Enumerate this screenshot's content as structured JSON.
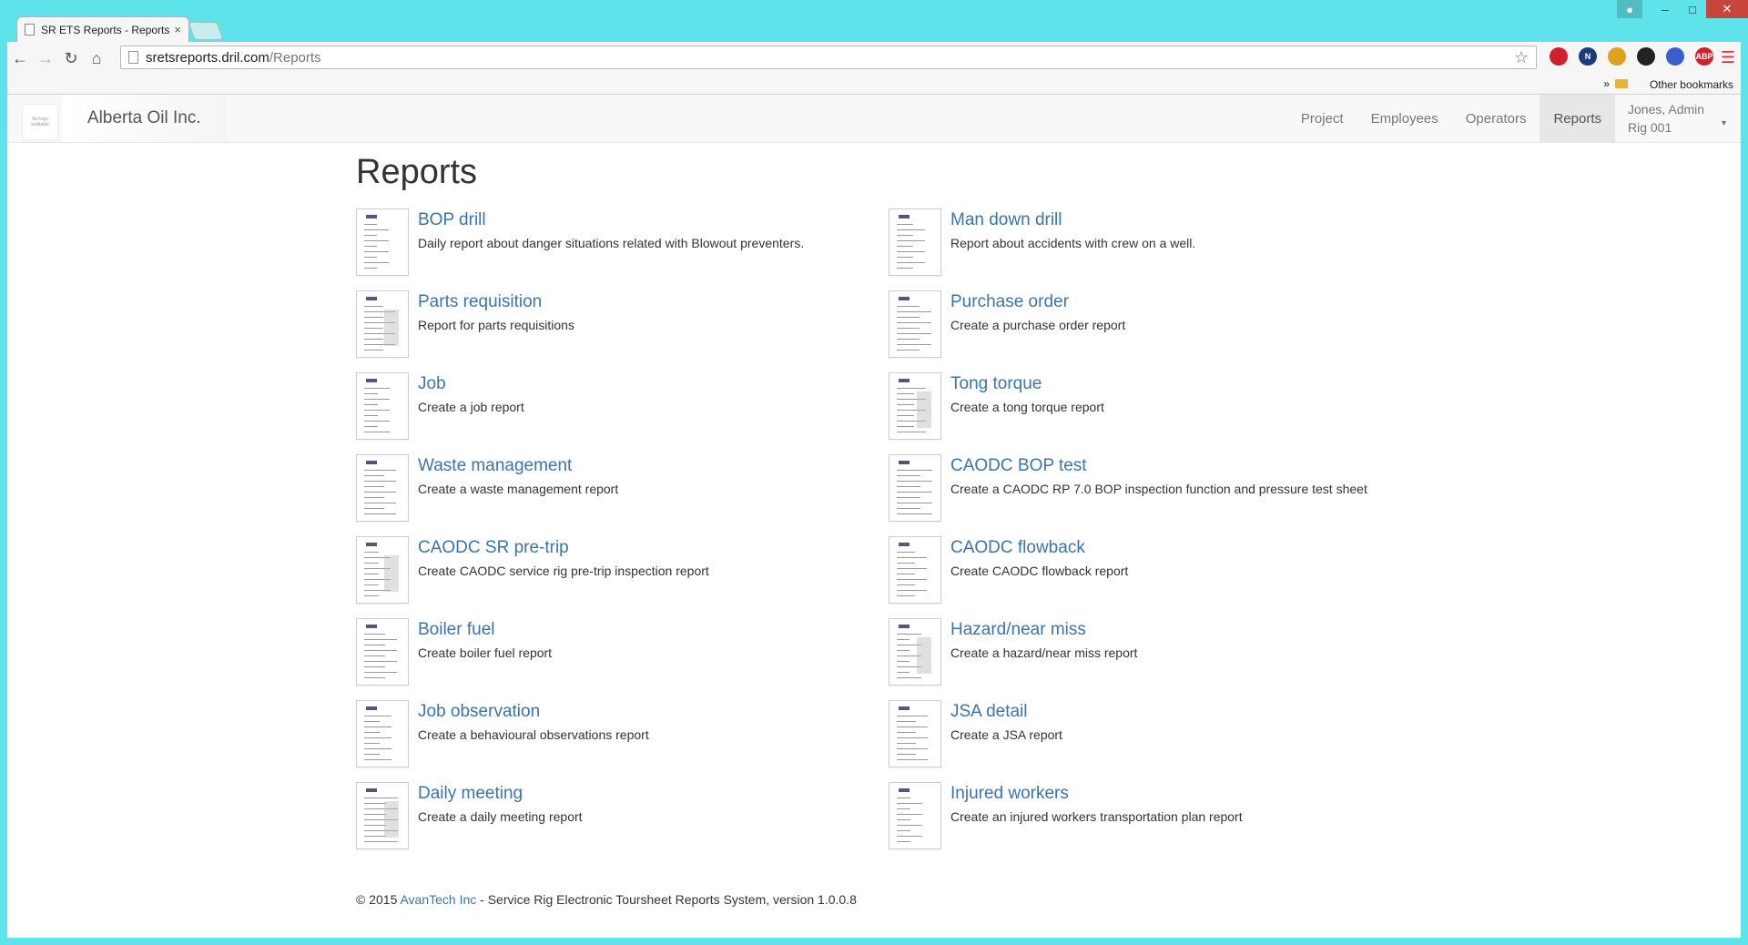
{
  "browser": {
    "tab_title": "SR ETS Reports - Reports",
    "tab_close": "×",
    "url_host": "sretsreports.dril.com",
    "url_path": "/Reports",
    "bookmarks_chevron": "»",
    "other_bookmarks": "Other bookmarks",
    "extensions": [
      {
        "name": "opera-icon",
        "label": "",
        "color": "#d0202a"
      },
      {
        "name": "notes-icon",
        "label": "N",
        "color": "#1b3b7c"
      },
      {
        "name": "pinwheel-icon",
        "label": "",
        "color": "#e0a020"
      },
      {
        "name": "eye-icon",
        "label": "",
        "color": "#222222"
      },
      {
        "name": "globe-icon",
        "label": "",
        "color": "#3a5fcc"
      },
      {
        "name": "adblock-icon",
        "label": "ABP",
        "color": "#d0202a"
      }
    ]
  },
  "navbar": {
    "logo_text": "No logo available",
    "brand": "Alberta Oil Inc.",
    "links": [
      "Project",
      "Employees",
      "Operators",
      "Reports"
    ],
    "active_link": "Reports",
    "user_name": "Jones, Admin",
    "user_rig": "Rig 001"
  },
  "page_title": "Reports",
  "reports_left": [
    {
      "title": "BOP drill",
      "desc": "Daily report about danger situations related with Blowout preventers."
    },
    {
      "title": "Parts requisition",
      "desc": "Report for parts requisitions"
    },
    {
      "title": "Job",
      "desc": "Create a job report"
    },
    {
      "title": "Waste management",
      "desc": "Create a waste management report"
    },
    {
      "title": "CAODC SR pre-trip",
      "desc": "Create CAODC service rig pre-trip inspection report"
    },
    {
      "title": "Boiler fuel",
      "desc": "Create boiler fuel report"
    },
    {
      "title": "Job observation",
      "desc": "Create a behavioural observations report"
    },
    {
      "title": "Daily meeting",
      "desc": "Create a daily meeting report"
    }
  ],
  "reports_right": [
    {
      "title": "Man down drill",
      "desc": "Report about accidents with crew on a well."
    },
    {
      "title": "Purchase order",
      "desc": "Create a purchase order report"
    },
    {
      "title": "Tong torque",
      "desc": "Create a tong torque report"
    },
    {
      "title": "CAODC BOP test",
      "desc": "Create a CAODC RP 7.0 BOP inspection function and pressure test sheet"
    },
    {
      "title": "CAODC flowback",
      "desc": "Create CAODC flowback report"
    },
    {
      "title": "Hazard/near miss",
      "desc": "Create a hazard/near miss report"
    },
    {
      "title": "JSA detail",
      "desc": "Create a JSA report"
    },
    {
      "title": "Injured workers",
      "desc": "Create an injured workers transportation plan report"
    }
  ],
  "footer": {
    "prefix": "© 2015 ",
    "company": "AvanTech Inc",
    "suffix": " - Service Rig Electronic Toursheet Reports System, version 1.0.0.8"
  }
}
